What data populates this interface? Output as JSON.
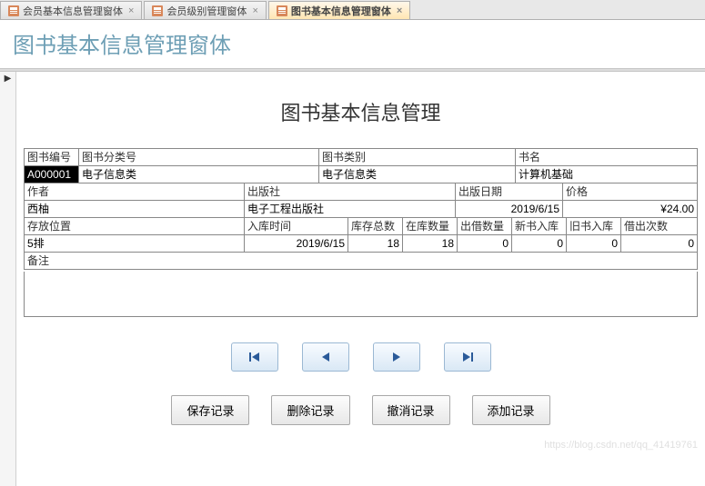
{
  "tabs": [
    {
      "label": "会员基本信息管理窗体",
      "active": false
    },
    {
      "label": "会员级别管理窗体",
      "active": false
    },
    {
      "label": "图书基本信息管理窗体",
      "active": true
    }
  ],
  "band_title": "图书基本信息管理窗体",
  "page_title": "图书基本信息管理",
  "labels": {
    "book_id": "图书编号",
    "cat_id": "图书分类号",
    "cat_name": "图书类别",
    "book_name": "书名",
    "author": "作者",
    "publisher": "出版社",
    "pub_date": "出版日期",
    "price": "价格",
    "location": "存放位置",
    "in_date": "入库时间",
    "stock_total": "库存总数",
    "in_stock": "在库数量",
    "lent": "出借数量",
    "new_in": "新书入库",
    "old_in": "旧书入库",
    "lend_count": "借出次数",
    "remark": "备注"
  },
  "values": {
    "book_id": "A000001",
    "cat_id": "电子信息类",
    "cat_name": "电子信息类",
    "book_name": "计算机基础",
    "author": "西柚",
    "publisher": "电子工程出版社",
    "pub_date": "2019/6/15",
    "price": "¥24.00",
    "location": "5排",
    "in_date": "2019/6/15",
    "stock_total": "18",
    "in_stock": "18",
    "lent": "0",
    "new_in": "0",
    "old_in": "0",
    "lend_count": "0",
    "remark": ""
  },
  "nav": {
    "first": "first",
    "prev": "prev",
    "next": "next",
    "last": "last"
  },
  "actions": {
    "save": "保存记录",
    "delete": "删除记录",
    "cancel": "撤消记录",
    "add": "添加记录"
  },
  "watermark": "https://blog.csdn.net/qq_41419761"
}
